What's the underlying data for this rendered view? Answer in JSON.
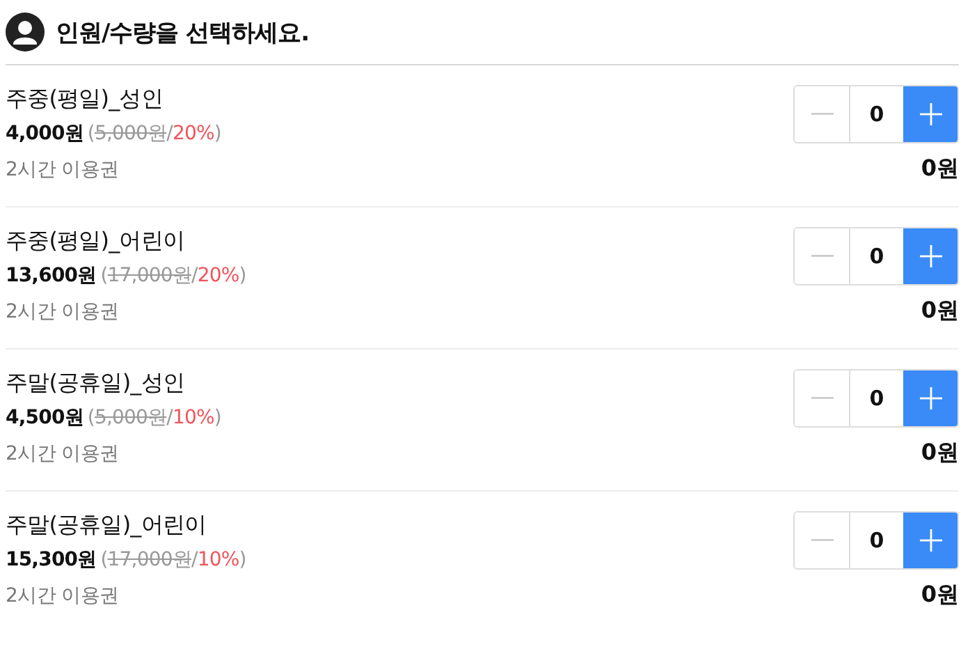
{
  "header": {
    "title": "인원/수량을 선택하세요."
  },
  "items": [
    {
      "name": "주중(평일)_성인",
      "price": "4,000원",
      "discount_parts": [
        {
          "kind": "plain",
          "text": "("
        },
        {
          "kind": "struck",
          "text": "5,000원"
        },
        {
          "kind": "plain",
          "text": "/"
        },
        {
          "kind": "rate",
          "text": "20%"
        },
        {
          "kind": "plain",
          "text": ")"
        }
      ],
      "note": "2시간 이용권",
      "quantity": "0",
      "minus_disabled": true,
      "total": "0원"
    },
    {
      "name": "주중(평일)_어린이",
      "price": "13,600원",
      "discount_parts": [
        {
          "kind": "plain",
          "text": "("
        },
        {
          "kind": "struck",
          "text": "17,000원"
        },
        {
          "kind": "plain",
          "text": "/"
        },
        {
          "kind": "rate",
          "text": "20%"
        },
        {
          "kind": "plain",
          "text": ")"
        }
      ],
      "note": "2시간 이용권",
      "quantity": "0",
      "minus_disabled": true,
      "total": "0원"
    },
    {
      "name": "주말(공휴일)_성인",
      "price": "4,500원",
      "discount_parts": [
        {
          "kind": "plain",
          "text": "("
        },
        {
          "kind": "struck",
          "text": "5,000원"
        },
        {
          "kind": "plain",
          "text": "/"
        },
        {
          "kind": "rate",
          "text": "10%"
        },
        {
          "kind": "plain",
          "text": ")"
        }
      ],
      "note": "2시간 이용권",
      "quantity": "0",
      "minus_disabled": true,
      "total": "0원"
    },
    {
      "name": "주말(공휴일)_어린이",
      "price": "15,300원",
      "discount_parts": [
        {
          "kind": "plain",
          "text": "("
        },
        {
          "kind": "struck",
          "text": "17,000원"
        },
        {
          "kind": "plain",
          "text": "/"
        },
        {
          "kind": "rate",
          "text": "10%"
        },
        {
          "kind": "plain",
          "text": ")"
        }
      ],
      "note": "2시간 이용권",
      "quantity": "0",
      "minus_disabled": true,
      "total": "0원"
    }
  ]
}
